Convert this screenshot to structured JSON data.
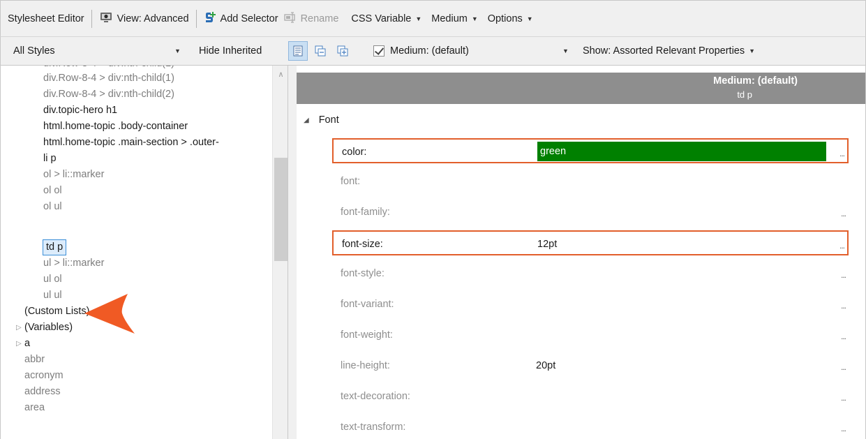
{
  "toolbar": {
    "title": "Stylesheet Editor",
    "view_label": "View: Advanced",
    "add_selector_label": "Add Selector",
    "rename_label": "Rename",
    "css_variable_label": "CSS Variable",
    "medium_label": "Medium",
    "options_label": "Options"
  },
  "toolbar2": {
    "styles_filter": "All Styles",
    "hide_inherited_label": "Hide Inherited",
    "medium_filter": "Medium: (default)",
    "show_filter": "Show: Assorted Relevant Properties"
  },
  "tree": {
    "items": [
      {
        "label": "div.Row-8-4 > div:nth-child(1)",
        "style": "grey"
      },
      {
        "label": "div.Row-8-4 > div:nth-child(2)",
        "style": "grey"
      },
      {
        "label": "div.topic-hero h1",
        "style": "dark"
      },
      {
        "label": "html.home-topic .body-container",
        "style": "dark"
      },
      {
        "label": "html.home-topic .main-section > .outer-",
        "style": "dark"
      },
      {
        "label": "li p",
        "style": "dark"
      },
      {
        "label": "ol > li::marker",
        "style": "grey"
      },
      {
        "label": "ol ol",
        "style": "grey"
      },
      {
        "label": "ol ul",
        "style": "grey"
      },
      {
        "label": "td p",
        "style": "selected"
      },
      {
        "label": "ul > li::marker",
        "style": "grey"
      },
      {
        "label": "ul ol",
        "style": "grey"
      },
      {
        "label": "ul ul",
        "style": "grey"
      },
      {
        "label": "(Custom Lists)",
        "style": "dark"
      },
      {
        "label": "(Variables)",
        "style": "dark"
      },
      {
        "label": "a",
        "style": "dark"
      },
      {
        "label": "abbr",
        "style": "grey"
      },
      {
        "label": "acronym",
        "style": "grey"
      },
      {
        "label": "address",
        "style": "grey"
      },
      {
        "label": "area",
        "style": "grey"
      }
    ]
  },
  "props": {
    "header_title": "Medium: (default)",
    "header_subtitle": "td p",
    "group_label": "Font",
    "more_label": "...",
    "rows": [
      {
        "name": "color:",
        "value": "green",
        "active": true,
        "highlight": true,
        "swatch": "#008000"
      },
      {
        "name": "font:",
        "value": "",
        "active": false
      },
      {
        "name": "font-family:",
        "value": "",
        "active": false
      },
      {
        "name": "font-size:",
        "value": "12pt",
        "active": true,
        "highlight": true
      },
      {
        "name": "font-style:",
        "value": "",
        "active": false
      },
      {
        "name": "font-variant:",
        "value": "",
        "active": false
      },
      {
        "name": "font-weight:",
        "value": "",
        "active": false
      },
      {
        "name": "line-height:",
        "value": "20pt",
        "active": false
      },
      {
        "name": "text-decoration:",
        "value": "",
        "active": false
      },
      {
        "name": "text-transform:",
        "value": "",
        "active": false
      }
    ]
  },
  "colors": {
    "highlight_border": "#e25f2b",
    "selection_border": "#3c8fd8",
    "header_bg": "#8e8e8e",
    "callout": "#f05a24"
  }
}
